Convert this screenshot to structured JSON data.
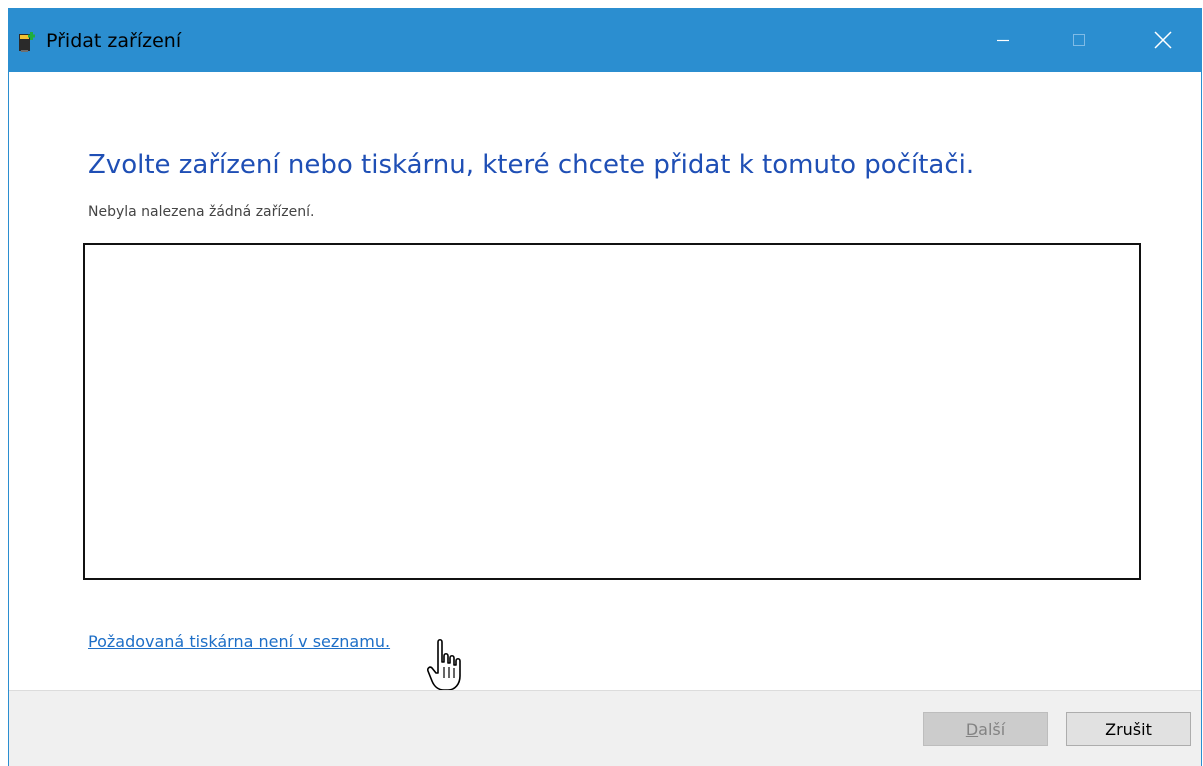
{
  "window": {
    "title": "Přidat zařízení",
    "title_icon": "device-add-icon",
    "accent_color": "#2b8ed0",
    "controls": {
      "minimize": "minimize-icon",
      "maximize": "maximize-icon",
      "close": "close-icon"
    }
  },
  "main": {
    "heading": "Zvolte zařízení nebo tiskárnu, které chcete přidat k tomuto počítači.",
    "status": "Nebyla nalezena žádná zařízení.",
    "devices": [],
    "printer_link": "Požadovaná tiskárna není v seznamu."
  },
  "footer": {
    "next_label_mnemonic": "D",
    "next_label_rest": "alší",
    "next_enabled": false,
    "cancel_label": "Zrušit"
  },
  "cursor": "hand-pointer-icon"
}
